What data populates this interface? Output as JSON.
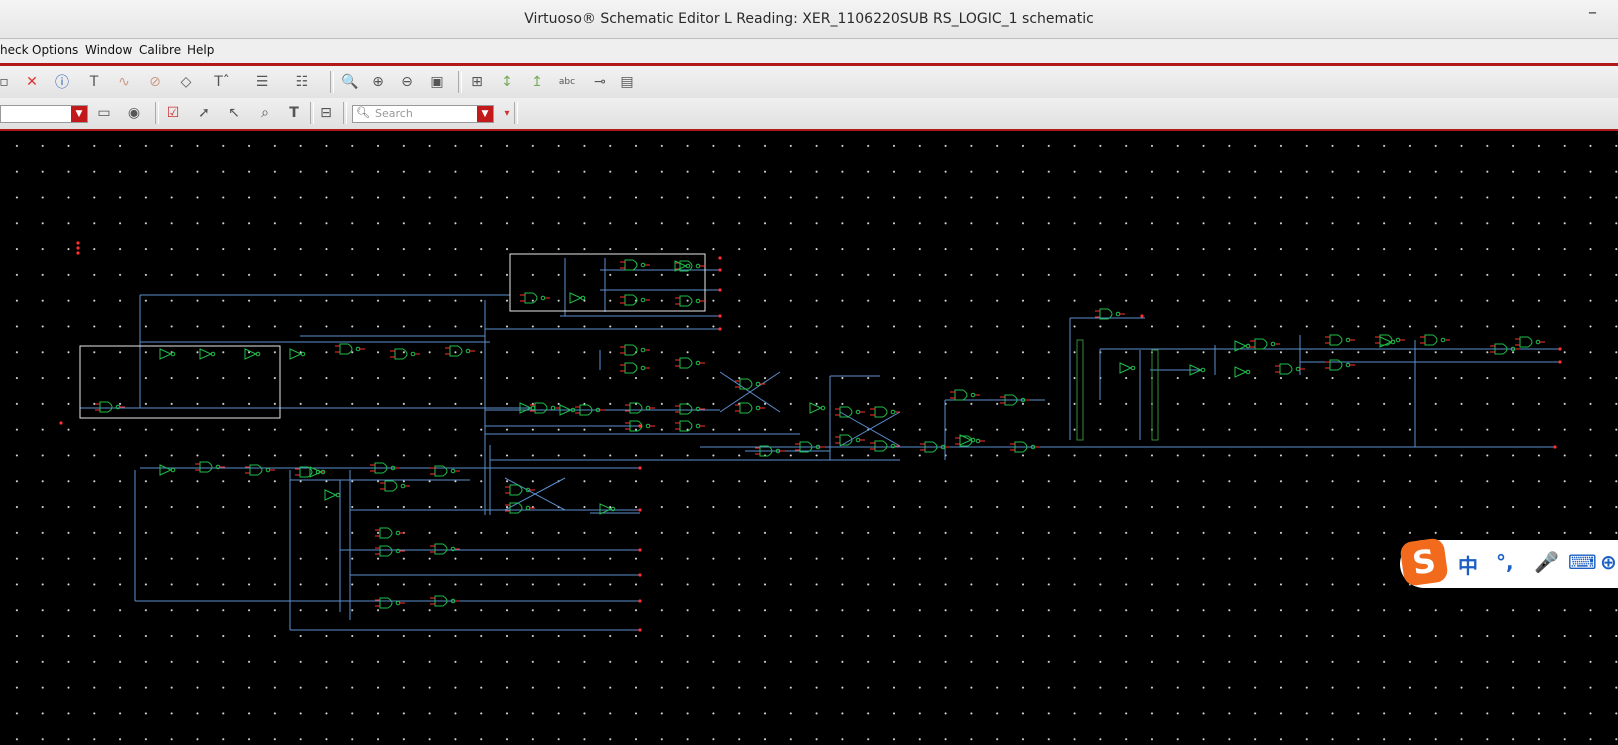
{
  "window": {
    "title": "Virtuoso® Schematic Editor L Reading: XER_1106220SUB RS_LOGIC_1 schematic",
    "minimize_glyph": "–"
  },
  "menubar": {
    "items": [
      "heck",
      "Options",
      "Window",
      "Calibre",
      "Help"
    ]
  },
  "toolbar": {
    "search_placeholder": "Search",
    "icons": [
      "undo-icon",
      "delete-icon",
      "info-icon",
      "text-edit-icon",
      "wire-icon",
      "pin-icon",
      "property-icon",
      "font-icon",
      "align-icon",
      "distribute-icon",
      "zoom-fit-icon",
      "zoom-in-icon",
      "zoom-out-icon",
      "zoom-area-icon",
      "hierarchy-icon",
      "stretch-icon",
      "label-icon",
      "abc-icon",
      "key-icon",
      "sheet-icon"
    ]
  },
  "ime": {
    "logo": "S",
    "mode": "中",
    "punct": "°,",
    "mic": "🎤",
    "kbd": "⌨"
  },
  "colors": {
    "accent": "#b21a1a",
    "wire": "#5b8fd0",
    "gate": "#21c04a",
    "pin": "#ff3030",
    "box": "#e8e8e8",
    "canvas": "#000000"
  }
}
